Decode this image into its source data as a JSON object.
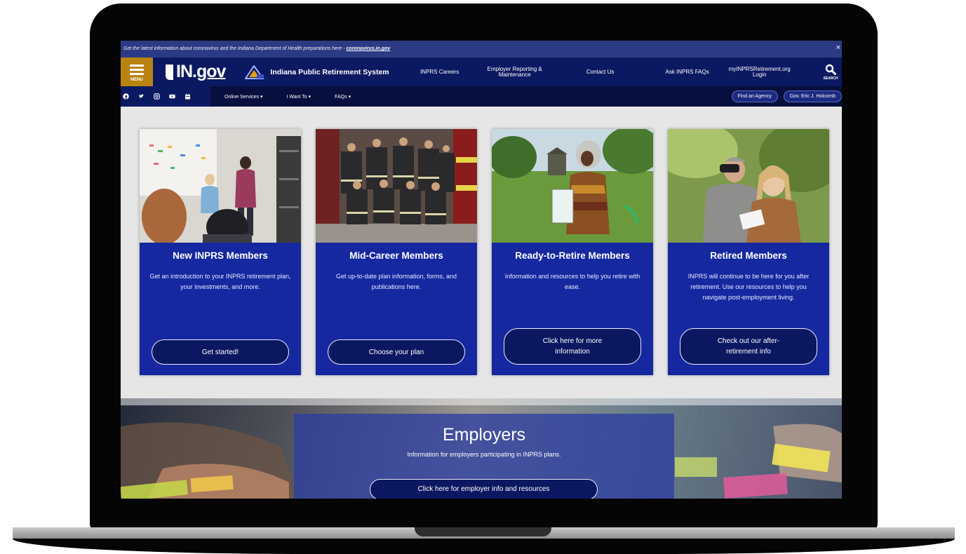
{
  "alert": {
    "text": "Get the latest information about coronavirus and the Indiana Department of Health preparations here - ",
    "link": "coronavirus.in.gov",
    "close": "×"
  },
  "header": {
    "menu_label": "MENU",
    "ingov_in": "IN.",
    "ingov_gov": "gov",
    "agency_name": "Indiana Public Retirement System",
    "nav": {
      "careers": "INPRS Careers",
      "employer_line1": "Employer Reporting &",
      "employer_line2": "Maintenance",
      "contact": "Contact Us",
      "faqs": "Ask INPRS FAQs",
      "login_line1": "myINPRSRetirement.org",
      "login_line2": "Login"
    },
    "search_label": "SEARCH"
  },
  "subnav": {
    "social_icons": [
      "facebook-icon",
      "twitter-icon",
      "instagram-icon",
      "youtube-icon",
      "calendar-icon"
    ],
    "online_services": "Online Services ▾",
    "i_want_to": "I Want To ▾",
    "faqs": "FAQs ▾",
    "find_agency": "Find an Agency",
    "governor": "Gov. Eric J. Holcomb"
  },
  "cards": [
    {
      "title": "New INPRS Members",
      "desc": "Get an introduction to your INPRS retirement plan, your investments, and more.",
      "button": "Get started!"
    },
    {
      "title": "Mid-Career Members",
      "desc": "Get up-to-date plan information, forms, and publications here.",
      "button": "Choose your plan"
    },
    {
      "title": "Ready-to-Retire Members",
      "desc": "Information and resources to help you retire with ease.",
      "button_line1": "Click here for more",
      "button_line2": "information"
    },
    {
      "title": "Retired Members",
      "desc": "INPRS will continue to be here for you after retirement. Use our resources to help you navigate post-employment living.",
      "button_line1": "Check out our after-",
      "button_line2": "retirement info"
    }
  ],
  "employers": {
    "title": "Employers",
    "desc": "Information for employers participating in INPRS plans.",
    "button": "Click here for employer info and resources"
  },
  "colors": {
    "alert_bar": "#2c3a86",
    "header": "#0b1962",
    "menu_button": "#b9830f",
    "card_blue": "#1528a0",
    "button_dark": "#0b1861"
  }
}
